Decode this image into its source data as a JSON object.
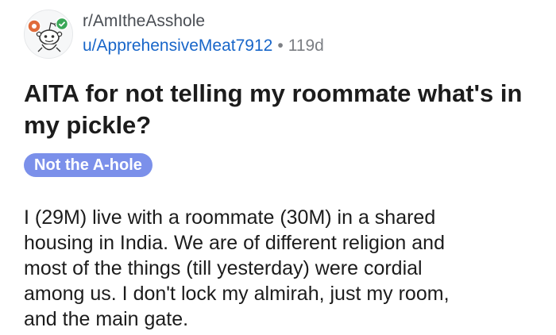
{
  "post": {
    "subreddit": "r/AmItheAsshole",
    "author": "u/ApprehensiveMeat7912",
    "separator": "•",
    "age": "119d",
    "title": "AITA for not telling my roommate what's in my pickle?",
    "flair": "Not the A-hole",
    "body_lines": [
      "I (29M) live with a roommate (30M) in a shared",
      "housing in India. We are of different religion and",
      "most of the things (till yesterday) were cordial",
      "among us. I don't lock my almirah, just my room,",
      "and the main gate."
    ]
  },
  "colors": {
    "username": "#1866c9",
    "flair_bg": "#7b90ea",
    "meta_gray": "#7c7f84"
  },
  "icons": {
    "avatar": "reddit-snoo-avatar-icon",
    "badge_left": "award-badge-icon",
    "badge_right": "verified-check-badge-icon"
  }
}
